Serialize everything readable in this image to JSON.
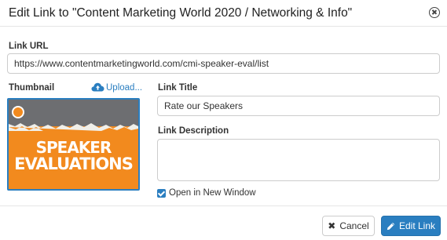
{
  "dialog": {
    "title": "Edit Link to \"Content Marketing World 2020 / Networking & Info\"",
    "close_icon": "close-circle-icon"
  },
  "form": {
    "link_url": {
      "label": "Link URL",
      "value": "https://www.contentmarketingworld.com/cmi-speaker-eval/list"
    },
    "thumbnail": {
      "label": "Thumbnail",
      "upload_label": "Upload...",
      "upload_icon": "cloud-upload-icon",
      "image_text": [
        "SPEAKER",
        "EVALUATIONS"
      ]
    },
    "link_title": {
      "label": "Link Title",
      "value": "Rate our Speakers"
    },
    "link_description": {
      "label": "Link Description",
      "value": ""
    },
    "open_new_window": {
      "label": "Open in New Window",
      "checked": true
    }
  },
  "footer": {
    "cancel_label": "Cancel",
    "cancel_icon": "x-icon",
    "edit_label": "Edit Link",
    "edit_icon": "pencil-icon"
  },
  "colors": {
    "accent": "#2a7ec0",
    "thumbnail_orange": "#f28a1e",
    "thumbnail_gray": "#6d6e71"
  }
}
